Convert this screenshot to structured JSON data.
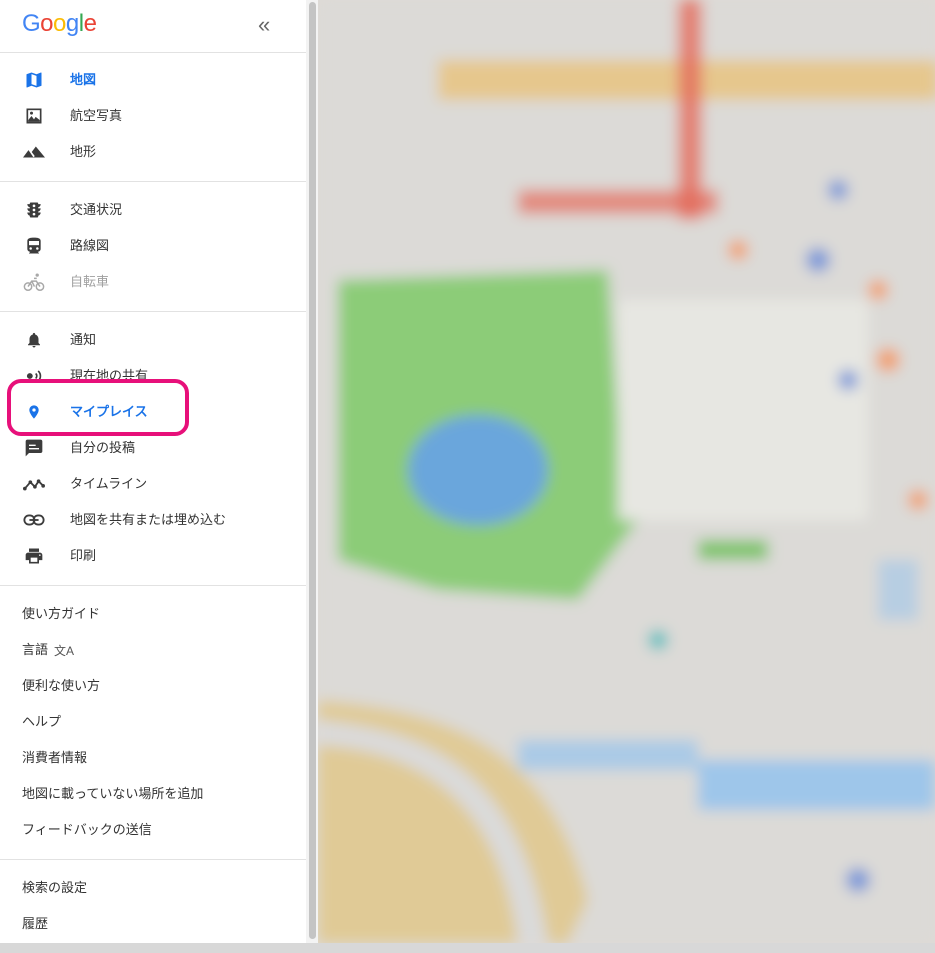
{
  "header": {
    "logo_letters": [
      {
        "ch": "G",
        "color": "#4285F4"
      },
      {
        "ch": "o",
        "color": "#EA4335"
      },
      {
        "ch": "o",
        "color": "#FBBC05"
      },
      {
        "ch": "g",
        "color": "#4285F4"
      },
      {
        "ch": "l",
        "color": "#34A853"
      },
      {
        "ch": "e",
        "color": "#EA4335"
      }
    ],
    "collapse_label": "«"
  },
  "groups": {
    "map_types": [
      {
        "label": "地図",
        "icon": "map-icon",
        "active": true
      },
      {
        "label": "航空写真",
        "icon": "satellite-image-icon"
      },
      {
        "label": "地形",
        "icon": "terrain-icon"
      }
    ],
    "layers": [
      {
        "label": "交通状況",
        "icon": "traffic-light-icon"
      },
      {
        "label": "路線図",
        "icon": "train-icon"
      },
      {
        "label": "自転車",
        "icon": "bicycle-icon",
        "disabled": true
      }
    ],
    "personal": [
      {
        "label": "通知",
        "icon": "bell-icon"
      },
      {
        "label": "現在地の共有",
        "icon": "location-sharing-icon"
      },
      {
        "label": "マイプレイス",
        "icon": "place-pin-icon",
        "active": true
      },
      {
        "label": "自分の投稿",
        "icon": "contributions-icon"
      },
      {
        "label": "タイムライン",
        "icon": "timeline-icon"
      },
      {
        "label": "地図を共有または埋め込む",
        "icon": "link-icon"
      },
      {
        "label": "印刷",
        "icon": "print-icon"
      }
    ],
    "help": [
      {
        "label": "使い方ガイド"
      },
      {
        "label": "言語"
      },
      {
        "label": "便利な使い方"
      },
      {
        "label": "ヘルプ"
      },
      {
        "label": "消費者情報"
      },
      {
        "label": "地図に載っていない場所を追加"
      },
      {
        "label": "フィードバックの送信"
      }
    ],
    "settings": [
      {
        "label": "検索の設定"
      },
      {
        "label": "履歴"
      }
    ]
  },
  "colors": {
    "accent": "#1a73e8",
    "highlight": "#e7107a",
    "icon": "#3c3c3c",
    "disabled_icon": "#a8a8a8"
  }
}
